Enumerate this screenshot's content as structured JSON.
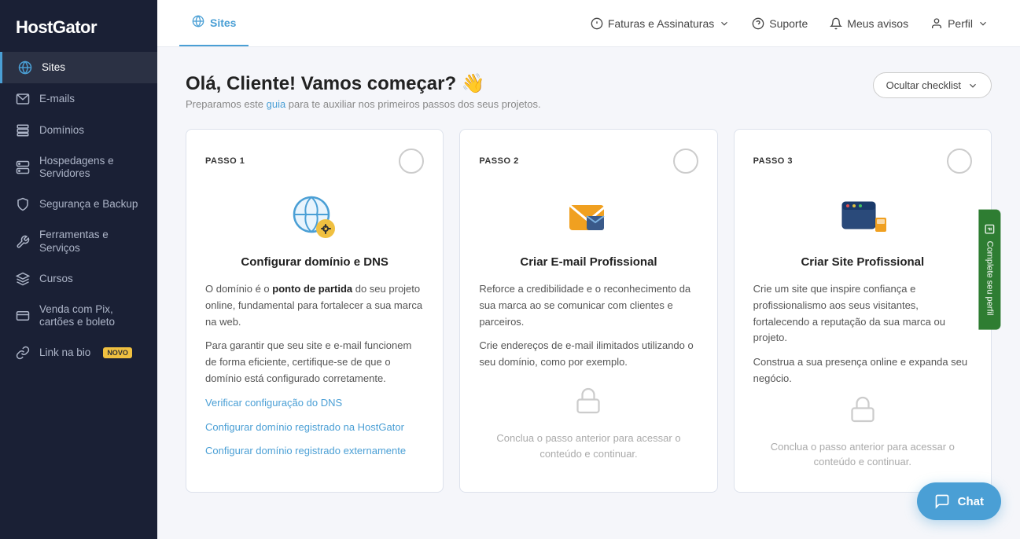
{
  "brand": {
    "name": "HostGator"
  },
  "sidebar": {
    "items": [
      {
        "id": "sites",
        "label": "Sites",
        "icon": "globe",
        "active": true,
        "badge": null
      },
      {
        "id": "emails",
        "label": "E-mails",
        "icon": "email",
        "active": false,
        "badge": null
      },
      {
        "id": "domains",
        "label": "Domínios",
        "icon": "domain",
        "active": false,
        "badge": null
      },
      {
        "id": "hosting",
        "label": "Hospedagens e Servidores",
        "icon": "server",
        "active": false,
        "badge": null
      },
      {
        "id": "security",
        "label": "Segurança e Backup",
        "icon": "shield",
        "active": false,
        "badge": null
      },
      {
        "id": "tools",
        "label": "Ferramentas e Serviços",
        "icon": "tools",
        "active": false,
        "badge": null
      },
      {
        "id": "courses",
        "label": "Cursos",
        "icon": "courses",
        "active": false,
        "badge": null
      },
      {
        "id": "pix",
        "label": "Venda com Pix, cartões e boleto",
        "icon": "pix",
        "active": false,
        "badge": null
      },
      {
        "id": "linknabio",
        "label": "Link na bio",
        "icon": "link",
        "active": false,
        "badge": "NOVO"
      }
    ]
  },
  "topnav": {
    "active_item": "Sites",
    "items": [
      {
        "id": "sites",
        "label": "Sites",
        "icon": "globe"
      }
    ],
    "right_items": [
      {
        "id": "billing",
        "label": "Faturas e Assinaturas",
        "has_dropdown": true
      },
      {
        "id": "support",
        "label": "Suporte",
        "has_dropdown": false
      },
      {
        "id": "notifications",
        "label": "Meus avisos",
        "has_dropdown": false
      },
      {
        "id": "profile",
        "label": "Perfil",
        "has_dropdown": true
      }
    ]
  },
  "page": {
    "greeting": "Olá, Cliente! Vamos começar? 👋",
    "subtitle_text": "Preparamos este ",
    "subtitle_link": "guia",
    "subtitle_rest": " para te auxiliar nos primeiros passos dos seus projetos.",
    "hide_checklist_label": "Ocultar checklist"
  },
  "steps": [
    {
      "id": "step1",
      "label": "PASSO 1",
      "title": "Configurar domínio e DNS",
      "locked": false,
      "body_paragraphs": [
        "O domínio é o <strong>ponto de partida</strong> do seu projeto online, fundamental para fortalecer a sua marca na web.",
        "Para garantir que seu site e e-mail funcionem de forma eficiente, certifique-se de que o domínio está configurado corretamente."
      ],
      "links": [
        {
          "text": "Verificar configuração do DNS",
          "href": "#"
        },
        {
          "text": "Configurar domínio registrado na HostGator",
          "href": "#"
        },
        {
          "text": "Configurar domínio registrado externamente",
          "href": "#"
        }
      ]
    },
    {
      "id": "step2",
      "label": "PASSO 2",
      "title": "Criar E-mail Profissional",
      "locked": true,
      "body_paragraphs": [
        "Reforce a credibilidade e o reconhecimento da sua marca ao se comunicar com clientes e parceiros.",
        "Crie endereços de e-mail ilimitados utilizando o seu domínio, como por exemplo."
      ],
      "locked_message": "Conclua o passo anterior para acessar o conteúdo e continuar."
    },
    {
      "id": "step3",
      "label": "PASSO 3",
      "title": "Criar Site Profissional",
      "locked": true,
      "body_paragraphs": [
        "Crie um site que inspire confiança e profissionalismo aos seus visitantes, fortalecendo a reputação da sua marca ou projeto.",
        "Construa a sua presença online e expanda seu negócio."
      ],
      "locked_message": "Conclua o passo anterior para acessar o conteúdo e continuar."
    }
  ],
  "chat": {
    "label": "Chat"
  },
  "profile_tab": {
    "label": "Complete seu perfil"
  }
}
